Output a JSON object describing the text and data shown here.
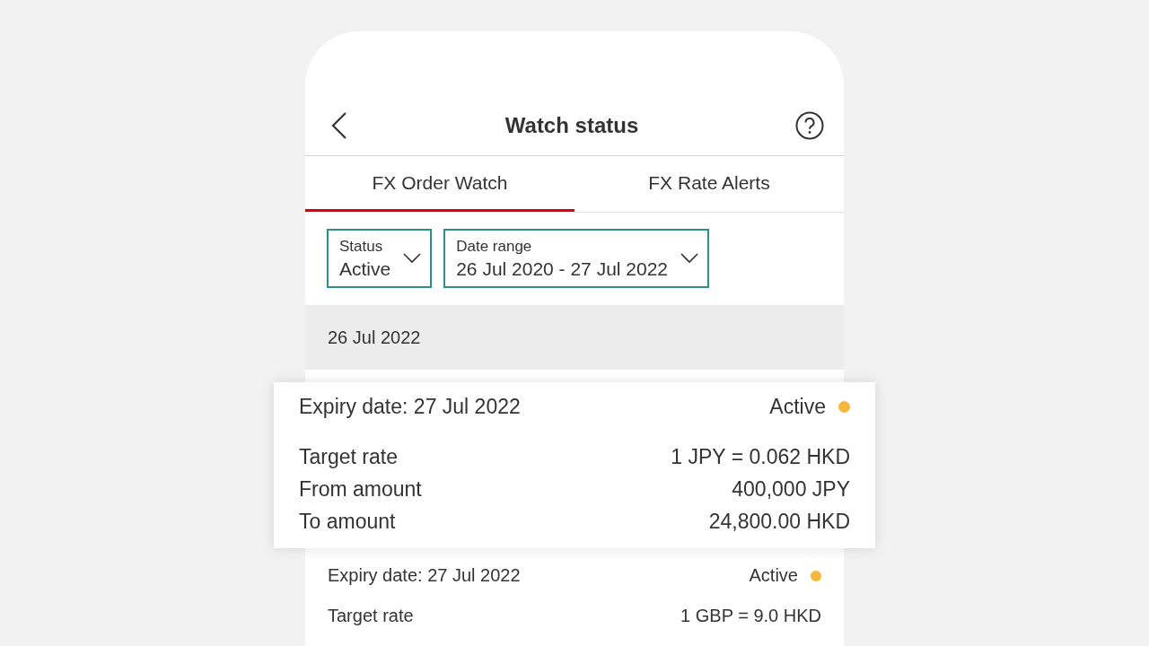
{
  "header": {
    "title": "Watch status"
  },
  "tabs": [
    {
      "label": "FX Order Watch",
      "selected": true
    },
    {
      "label": "FX Rate Alerts",
      "selected": false
    }
  ],
  "filters": [
    {
      "label": "Status",
      "value": "Active"
    },
    {
      "label": "Date range",
      "value": "26 Jul 2020 - 27 Jul 2022"
    }
  ],
  "groups": [
    {
      "date": "26 Jul 2022",
      "orders": [
        {
          "highlighted": true,
          "expiry": "Expiry date: 27 Jul 2022",
          "status": "Active",
          "color": "#f6b73c",
          "rows": [
            {
              "label": "Target rate",
              "value": "1 JPY = 0.062 HKD"
            },
            {
              "label": "From amount",
              "value": "400,000 JPY"
            },
            {
              "label": "To amount",
              "value": "24,800.00 HKD"
            }
          ]
        },
        {
          "highlighted": false,
          "expiry": "Expiry date: 27 Jul 2022",
          "status": "Active",
          "color": "#f6b73c",
          "rows": [
            {
              "label": "Target rate",
              "value": "1 GBP = 9.0 HKD"
            }
          ]
        }
      ]
    }
  ]
}
